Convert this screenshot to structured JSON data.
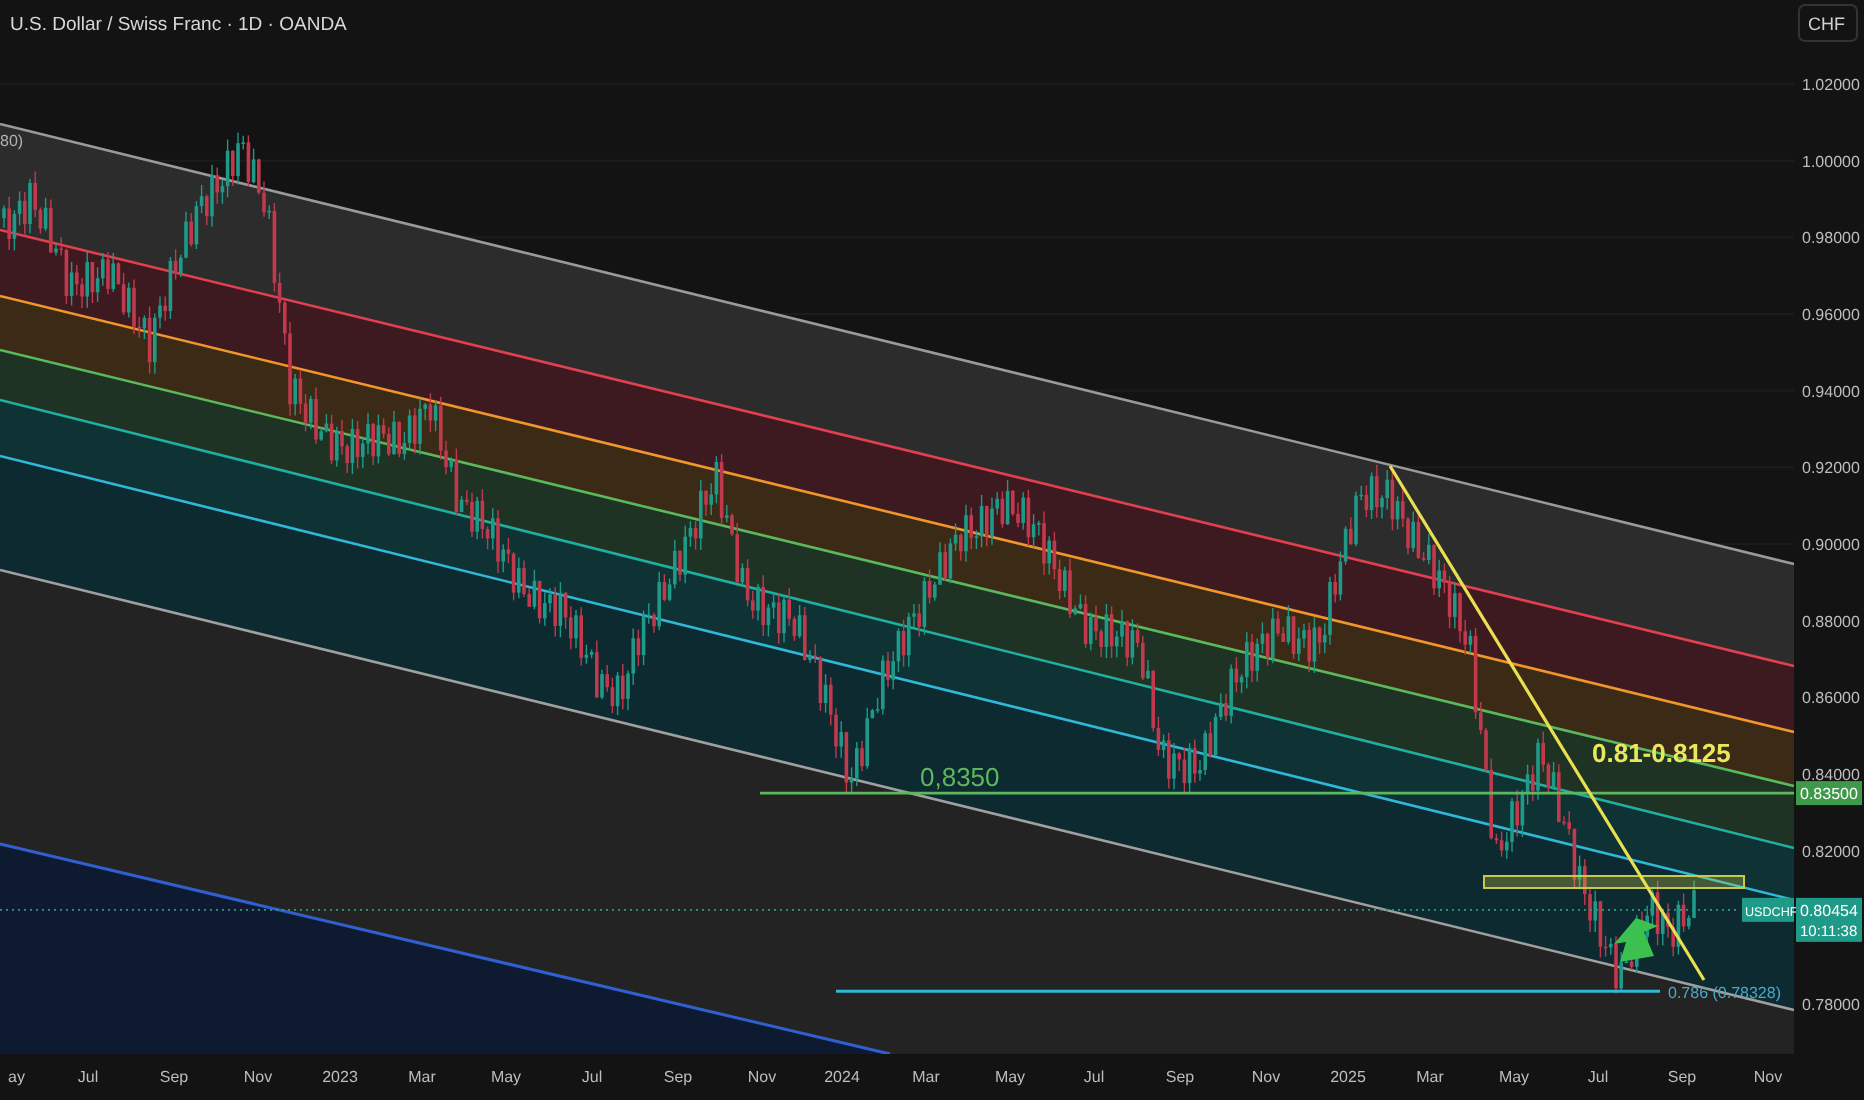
{
  "header": {
    "title": "U.S. Dollar / Swiss Franc · 1D · OANDA"
  },
  "price_scale": {
    "currency_button": "CHF",
    "ticks": [
      "1.02000",
      "1.00000",
      "0.98000",
      "0.96000",
      "0.94000",
      "0.92000",
      "0.90000",
      "0.88000",
      "0.86000",
      "0.84000",
      "0.82000",
      "0.78000"
    ],
    "level_tag": "0.83500",
    "symbol_tag": "USDCHF",
    "last_price": "0.80454",
    "countdown": "10:11:38"
  },
  "time_scale": {
    "labels": [
      "ay",
      "Jul",
      "Sep",
      "Nov",
      "2023",
      "Mar",
      "May",
      "Jul",
      "Sep",
      "Nov",
      "2024",
      "Mar",
      "May",
      "Jul",
      "Sep",
      "Nov",
      "2025",
      "Mar",
      "May",
      "Jul",
      "Sep",
      "Nov"
    ]
  },
  "annotations": [
    {
      "text": "80)",
      "color": "#b0b0b0"
    },
    {
      "text": "0,8350",
      "color": "#5cb85c"
    },
    {
      "text": "0.81-0.8125",
      "color": "#e8e85a"
    },
    {
      "text": "0.786 (0.78328)",
      "color": "#4aa8c8"
    }
  ]
}
